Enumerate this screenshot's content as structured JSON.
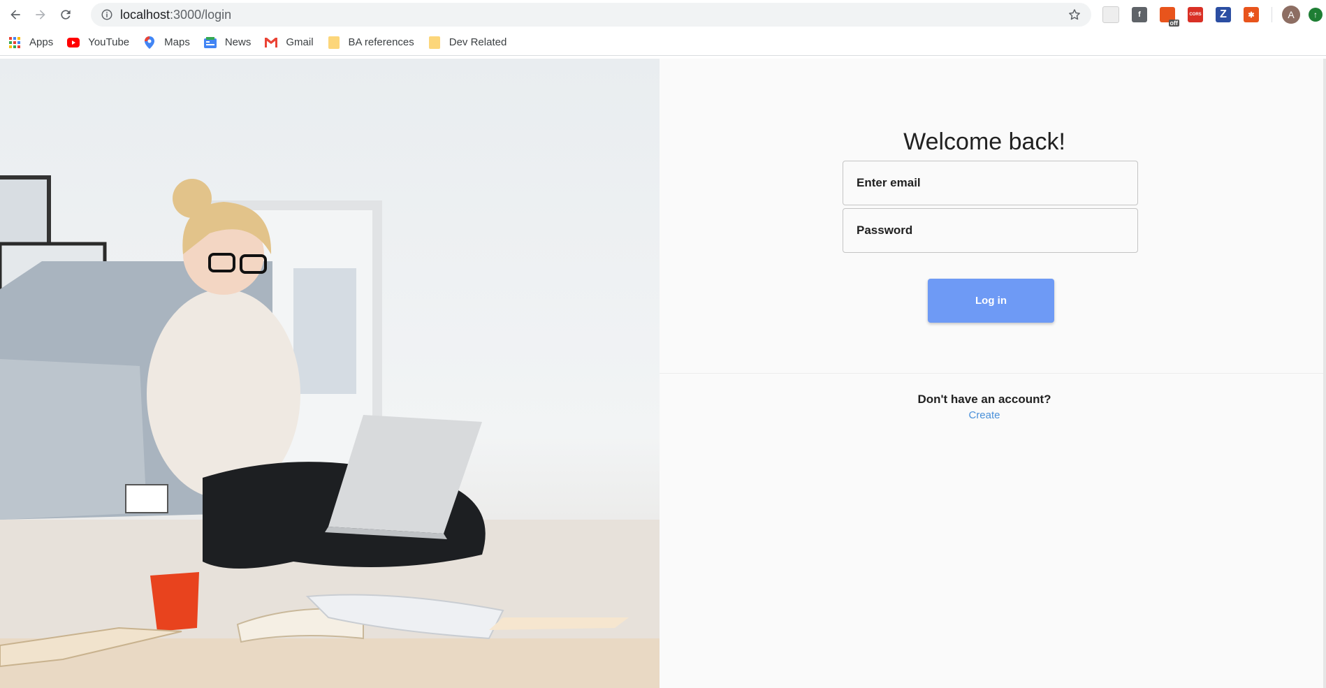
{
  "browser": {
    "url_host": "localhost",
    "url_path": ":3000/login",
    "bookmarks": [
      {
        "label": "Apps",
        "icon": "apps-grid-icon"
      },
      {
        "label": "YouTube",
        "icon": "youtube-icon"
      },
      {
        "label": "Maps",
        "icon": "maps-pin-icon"
      },
      {
        "label": "News",
        "icon": "news-icon"
      },
      {
        "label": "Gmail",
        "icon": "gmail-icon"
      },
      {
        "label": "BA references",
        "icon": "folder-icon"
      },
      {
        "label": "Dev Related",
        "icon": "folder-icon"
      }
    ],
    "extensions": [
      {
        "name": "ext-gray-icon",
        "color": "#e0e0e0"
      },
      {
        "name": "facebook-icon",
        "color": "#5f6368"
      },
      {
        "name": "off-ext-icon",
        "color": "#e8541c",
        "badge": "off"
      },
      {
        "name": "cors-icon",
        "color": "#d93025",
        "text": "CORS"
      },
      {
        "name": "z-icon",
        "color": "#2b4ea2",
        "text": "Z"
      },
      {
        "name": "bug-ext-icon",
        "color": "#e8541c"
      }
    ],
    "avatar_letter": "A"
  },
  "login": {
    "title": "Welcome back!",
    "email_placeholder": "Enter email",
    "password_placeholder": "Password",
    "submit_label": "Log in",
    "no_account_text": "Don't have an account?",
    "create_link": "Create"
  },
  "colors": {
    "button": "#6e9af5",
    "link": "#4a90d9",
    "panel_bg": "#fafafa"
  }
}
